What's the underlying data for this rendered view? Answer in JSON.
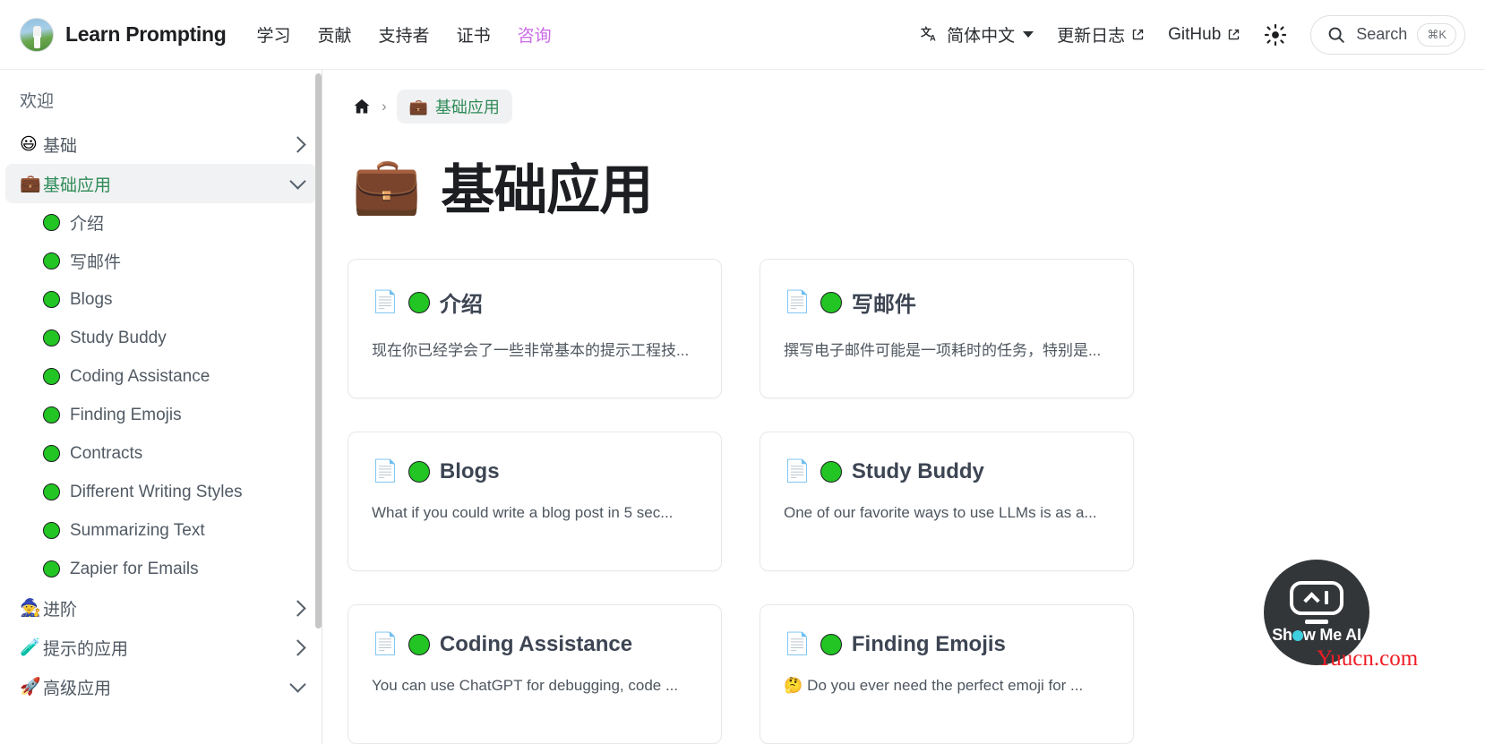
{
  "header": {
    "brand": "Learn Prompting",
    "logo_icon": "avatar-logo-icon",
    "nav_links": [
      {
        "label": "学习",
        "accent": false
      },
      {
        "label": "贡献",
        "accent": false
      },
      {
        "label": "支持者",
        "accent": false
      },
      {
        "label": "证书",
        "accent": false
      },
      {
        "label": "咨询",
        "accent": true
      }
    ],
    "language": {
      "icon": "translate-icon",
      "label": "简体中文"
    },
    "changelog": {
      "label": "更新日志",
      "icon": "external-link-icon"
    },
    "github": {
      "label": "GitHub",
      "icon": "external-link-icon"
    },
    "theme_toggle_icon": "sun-icon",
    "search": {
      "icon": "search-icon",
      "label": "Search",
      "shortcut": "⌘K"
    },
    "accent_color": "#cb6ce6"
  },
  "sidebar": {
    "welcome": "欢迎",
    "items": [
      {
        "emoji": "😃",
        "label": "基础",
        "state": "collapsed",
        "active": false
      },
      {
        "emoji": "💼",
        "label": "基础应用",
        "state": "expanded",
        "active": true
      }
    ],
    "sub_items": [
      {
        "label": "介绍"
      },
      {
        "label": "写邮件"
      },
      {
        "label": "Blogs"
      },
      {
        "label": "Study Buddy"
      },
      {
        "label": "Coding Assistance"
      },
      {
        "label": "Finding Emojis"
      },
      {
        "label": "Contracts"
      },
      {
        "label": "Different Writing Styles"
      },
      {
        "label": "Summarizing Text"
      },
      {
        "label": "Zapier for Emails"
      }
    ],
    "bottom_items": [
      {
        "emoji": "🧙",
        "label": "进阶",
        "state": "collapsed"
      },
      {
        "emoji": "🧪",
        "label": "提示的应用",
        "state": "collapsed"
      },
      {
        "emoji": "🚀",
        "label": "高级应用",
        "state": "expanded"
      }
    ],
    "active_color": "#2e8b57"
  },
  "breadcrumb": {
    "home_icon": "home-icon",
    "separator": "›",
    "current": {
      "emoji": "💼",
      "label": "基础应用"
    }
  },
  "page": {
    "emoji": "💼",
    "title": "基础应用"
  },
  "cards": [
    {
      "doc_icon": "📄",
      "title": "介绍",
      "description": "现在你已经学会了一些非常基本的提示工程技...",
      "lead_emoji": ""
    },
    {
      "doc_icon": "📄",
      "title": "写邮件",
      "description": "撰写电子邮件可能是一项耗时的任务，特别是...",
      "lead_emoji": ""
    },
    {
      "doc_icon": "📄",
      "title": "Blogs",
      "description": "What if you could write a blog post in 5 sec...",
      "lead_emoji": ""
    },
    {
      "doc_icon": "📄",
      "title": "Study Buddy",
      "description": "One of our favorite ways to use LLMs is as a...",
      "lead_emoji": ""
    },
    {
      "doc_icon": "📄",
      "title": "Coding Assistance",
      "description": "You can use ChatGPT for debugging, code ...",
      "lead_emoji": ""
    },
    {
      "doc_icon": "📄",
      "title": "Finding Emojis",
      "description": "Do you ever need the perfect emoji for ...",
      "lead_emoji": "🤔"
    }
  ],
  "floating_badge": {
    "label_prefix": "Sh",
    "label_suffix": "w Me AI",
    "icon": "robot-screen-icon"
  },
  "watermark": "Yuucn.com"
}
